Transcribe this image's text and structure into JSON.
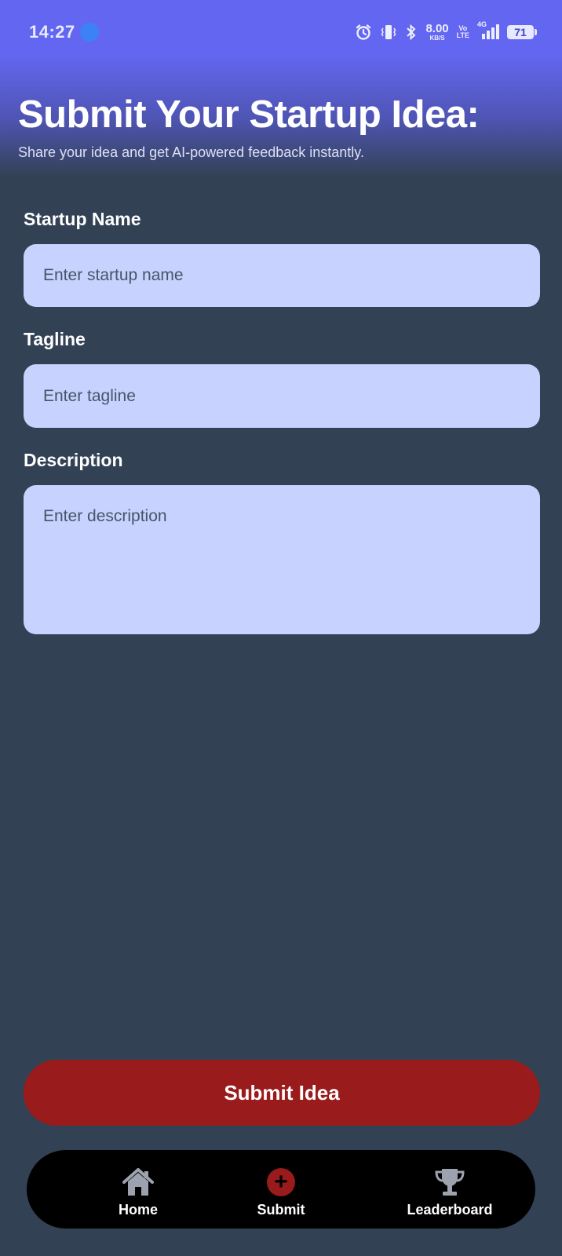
{
  "status_bar": {
    "time": "14:27",
    "net_speed": "8.00",
    "net_speed_unit": "KB/S",
    "volte_top": "Vo",
    "volte_bottom": "LTE",
    "signal_label": "4G",
    "battery": "71"
  },
  "header": {
    "title": "Submit Your Startup Idea:",
    "subtitle": "Share your idea and get AI-powered feedback instantly."
  },
  "form": {
    "startup_name": {
      "label": "Startup Name",
      "placeholder": "Enter startup name",
      "value": ""
    },
    "tagline": {
      "label": "Tagline",
      "placeholder": "Enter tagline",
      "value": ""
    },
    "description": {
      "label": "Description",
      "placeholder": "Enter description",
      "value": ""
    },
    "submit_label": "Submit Idea"
  },
  "bottom_nav": {
    "items": [
      {
        "label": "Home",
        "icon": "home-icon",
        "active": false
      },
      {
        "label": "Submit",
        "icon": "plus-circle-icon",
        "active": true
      },
      {
        "label": "Leaderboard",
        "icon": "trophy-icon",
        "active": false
      }
    ]
  },
  "colors": {
    "header_accent": "#6366f1",
    "background": "#334155",
    "input_background": "#c7d2fe",
    "primary_button": "#991b1b",
    "nav_background": "#000000",
    "nav_icon_inactive": "#9ca3af"
  }
}
